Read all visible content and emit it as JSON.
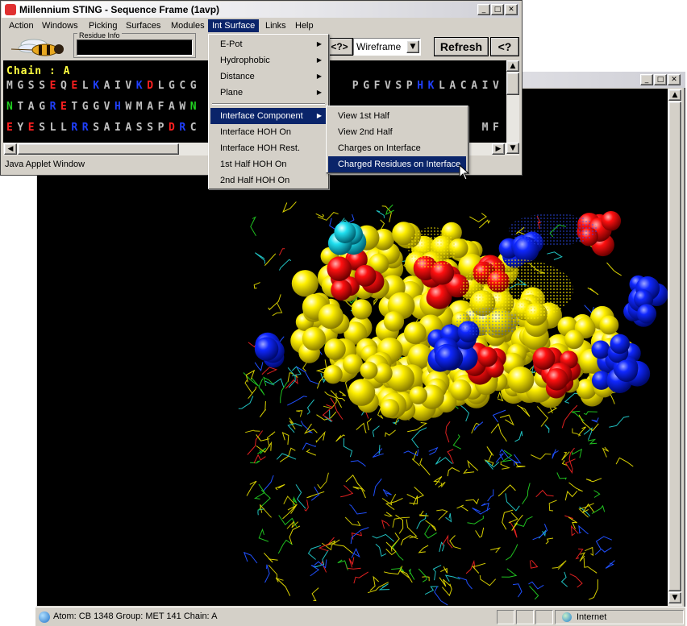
{
  "viewer_window": {
    "status_text": "Atom: CB 1348  Group: MET 141  Chain: A",
    "zone_label": "Internet"
  },
  "seq_window": {
    "title": "Millennium STING - Sequence Frame (1avp)",
    "menu": [
      "Action",
      "Windows",
      "Picking",
      "Surfaces",
      "Modules",
      "Int Surface",
      "Links",
      "Help"
    ],
    "active_menu": "Int Surface",
    "residue_info_label": "Residue Info",
    "render_mode": "Wireframe",
    "left_partial_button": "<?>",
    "refresh_button": "Refresh",
    "help_button": "<?",
    "chain_label": "Chain : A",
    "status": "Java Applet Window",
    "sequence_rows": [
      [
        "M",
        "G",
        "S",
        "S",
        "E",
        "Q",
        "E",
        "L",
        "K",
        "A",
        "I",
        "V",
        "K",
        "D",
        "L",
        "G",
        "C",
        "G",
        "",
        "",
        "",
        "",
        "",
        "",
        "",
        "",
        "",
        "",
        "",
        "",
        "",
        "",
        "P",
        "G",
        "F",
        "V",
        "S",
        "P",
        "H",
        "K",
        "L",
        "A",
        "C",
        "A",
        "I",
        "V"
      ],
      [
        "N",
        "T",
        "A",
        "G",
        "R",
        "E",
        "T",
        "G",
        "G",
        "V",
        "H",
        "W",
        "M",
        "A",
        "F",
        "A",
        "W",
        "N",
        "",
        "",
        "",
        "",
        "",
        "",
        "",
        "",
        "",
        "",
        "",
        "",
        "",
        "",
        "",
        "",
        "",
        "",
        "",
        "",
        "",
        "",
        "",
        "",
        "",
        "",
        "",
        ""
      ],
      [
        "E",
        "Y",
        "E",
        "S",
        "L",
        "L",
        "R",
        "R",
        "S",
        "A",
        "I",
        "A",
        "S",
        "S",
        "P",
        "D",
        "R",
        "C",
        "",
        "",
        "",
        "",
        "",
        "",
        "",
        "",
        "",
        "",
        "",
        "",
        "",
        "",
        "",
        "",
        "",
        "",
        "",
        "",
        "",
        "",
        "",
        "",
        "",
        "",
        "M",
        "F"
      ]
    ],
    "sequence_colors": [
      [
        "#c0c0c0",
        "#c0c0c0",
        "#c0c0c0",
        "#c0c0c0",
        "#ff2020",
        "#c0c0c0",
        "#ff2020",
        "#c0c0c0",
        "#2040ff",
        "#c0c0c0",
        "#c0c0c0",
        "#c0c0c0",
        "#2040ff",
        "#ff2020",
        "#c0c0c0",
        "#c0c0c0",
        "#c0c0c0",
        "#c0c0c0",
        "",
        "",
        "",
        "",
        "",
        "",
        "",
        "",
        "",
        "",
        "",
        "",
        "",
        "",
        "#c0c0c0",
        "#c0c0c0",
        "#c0c0c0",
        "#c0c0c0",
        "#c0c0c0",
        "#c0c0c0",
        "#2040ff",
        "#2040ff",
        "#c0c0c0",
        "#c0c0c0",
        "#c0c0c0",
        "#c0c0c0",
        "#c0c0c0",
        "#c0c0c0"
      ],
      [
        "#20d020",
        "#c0c0c0",
        "#c0c0c0",
        "#c0c0c0",
        "#2040ff",
        "#ff2020",
        "#c0c0c0",
        "#c0c0c0",
        "#c0c0c0",
        "#c0c0c0",
        "#2040ff",
        "#c0c0c0",
        "#c0c0c0",
        "#c0c0c0",
        "#c0c0c0",
        "#c0c0c0",
        "#c0c0c0",
        "#20d020",
        "",
        "",
        "",
        "",
        "",
        "",
        "",
        "",
        "",
        "",
        "",
        "",
        "",
        "",
        "",
        "",
        "",
        "",
        "",
        "",
        "",
        "",
        "",
        "",
        "",
        "",
        "",
        ""
      ],
      [
        "#ff2020",
        "#c0c0c0",
        "#ff2020",
        "#c0c0c0",
        "#c0c0c0",
        "#c0c0c0",
        "#2040ff",
        "#2040ff",
        "#c0c0c0",
        "#c0c0c0",
        "#c0c0c0",
        "#c0c0c0",
        "#c0c0c0",
        "#c0c0c0",
        "#c0c0c0",
        "#ff2020",
        "#2040ff",
        "#c0c0c0",
        "",
        "",
        "",
        "",
        "",
        "",
        "",
        "",
        "",
        "",
        "",
        "",
        "",
        "",
        "",
        "",
        "",
        "",
        "",
        "",
        "",
        "",
        "",
        "",
        "",
        "",
        "#c0c0c0",
        "#c0c0c0"
      ]
    ]
  },
  "int_surface_menu": {
    "items": [
      {
        "label": "E-Pot",
        "submenu": true
      },
      {
        "label": "Hydrophobic",
        "submenu": true
      },
      {
        "label": "Distance",
        "submenu": true
      },
      {
        "label": "Plane",
        "submenu": true
      },
      {
        "label": "Interface Component",
        "submenu": true,
        "highlighted": true
      },
      {
        "label": "Interface HOH On"
      },
      {
        "label": "Interface HOH Rest."
      },
      {
        "label": "1st Half HOH On"
      },
      {
        "label": "2nd Half HOH On"
      }
    ]
  },
  "interface_submenu": {
    "items": [
      {
        "label": "View 1st Half"
      },
      {
        "label": "View 2nd Half"
      },
      {
        "label": "Charges on Interface"
      },
      {
        "label": "Charged Residues on Interface",
        "highlighted": true
      }
    ]
  },
  "colors": {
    "menu_highlight": "#0a246a",
    "window_face": "#d4d0c8",
    "atom_yellow": "#ffee00",
    "atom_red": "#ff1010",
    "atom_blue": "#1028ff",
    "atom_cyan": "#20e0f0",
    "chain_label": "#ffff40"
  }
}
